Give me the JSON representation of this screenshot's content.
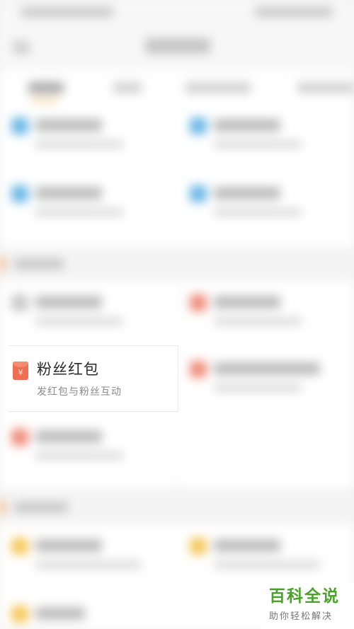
{
  "card": {
    "icon": "red-envelope-icon",
    "icon_glyph": "¥",
    "title": "粉丝红包",
    "subtitle": "发红包与粉丝互动"
  },
  "watermark": {
    "title": "百科全说",
    "subtitle": "助你轻松解决"
  },
  "colors": {
    "accent": "#f5a25a",
    "card_icon": "#ef6f54",
    "blue_icon": "#6ab8e6",
    "red_icon": "#ef8c7a",
    "yellow_icon": "#f4c85c",
    "watermark_green": "#4aa329"
  }
}
